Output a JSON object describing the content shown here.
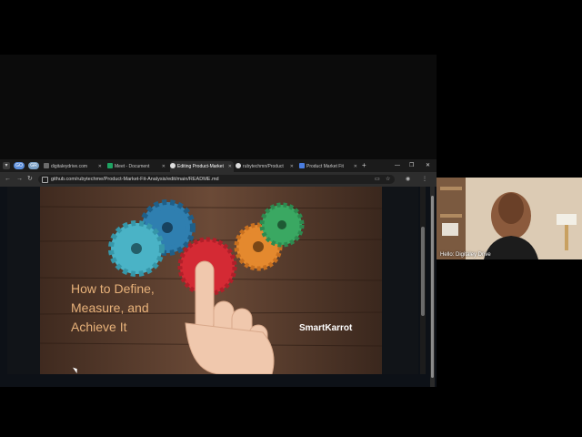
{
  "browser": {
    "tab_pills": [
      {
        "label": "GO",
        "color": "#5b8dd9"
      },
      {
        "label": "GR",
        "color": "#7a9fc4"
      }
    ],
    "tabs": [
      {
        "label": "digitaleydrive.com",
        "fav": "#6c6c6c",
        "active": false
      },
      {
        "label": "Meet - Document",
        "fav": "#1ea362",
        "active": false
      },
      {
        "label": "Editing Product-Market",
        "fav": "#dddddd",
        "active": true
      },
      {
        "label": "rubytechmn/Product",
        "fav": "#dddddd",
        "active": false
      },
      {
        "label": "Product Market Fit",
        "fav": "#4a7de0",
        "active": false
      }
    ],
    "new_tab": "+",
    "url": "github.com/rubytechme/Product-Market-Fit-Analysis/edit/main/README.md"
  },
  "content": {
    "headline_lines": [
      "How to Define,",
      "Measure, and",
      "Achieve It"
    ],
    "brand": "SmartKarrot",
    "cropped_title": "Product Market Fit"
  },
  "colors": {
    "headline": "#e8b27a",
    "wood_dark": "#3f2a1f",
    "wood_light": "#6b4a37",
    "gear_blue": "#2f7fb0",
    "gear_teal": "#4ab3c6",
    "gear_red": "#d42a34",
    "gear_orange": "#e4892e",
    "gear_green": "#3aa862"
  },
  "participant": {
    "name": "Hello: Digitaley Drive"
  }
}
